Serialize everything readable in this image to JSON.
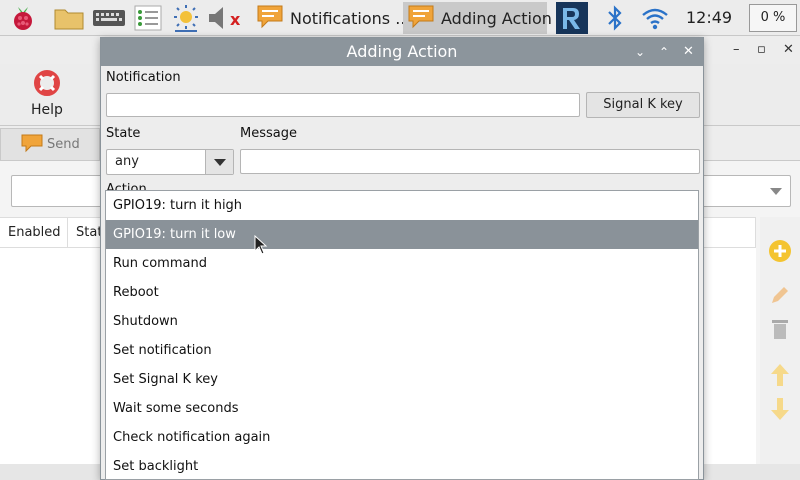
{
  "taskbar": {
    "windows": [
      {
        "label": "Notifications ...",
        "active": false
      },
      {
        "label": "Adding Action",
        "active": true
      }
    ],
    "clock": "12:49",
    "cpu": "0 %"
  },
  "background_window": {
    "toolbar": {
      "help_label": "Help"
    },
    "send_tab_label": "Send",
    "columns": [
      "Enabled",
      "Stat"
    ]
  },
  "dialog": {
    "title": "Adding Action",
    "notification_label": "Notification",
    "notification_value": "",
    "signalk_button": "Signal K key",
    "state_label": "State",
    "state_value": "any",
    "message_label": "Message",
    "message_value": "",
    "action_label": "Action"
  },
  "action_list": {
    "items": [
      "GPIO19: turn it high",
      "GPIO19: turn it low",
      "Run command",
      "Reboot",
      "Shutdown",
      "Set notification",
      "Set Signal K key",
      "Wait some seconds",
      "Check notification again",
      "Set backlight"
    ],
    "highlighted": "GPIO19: turn it low"
  },
  "colors": {
    "title_bar": "#8c959c",
    "highlight": "#8a9299",
    "add_icon": "#f4c430",
    "vnc_icon": "#17355a"
  }
}
